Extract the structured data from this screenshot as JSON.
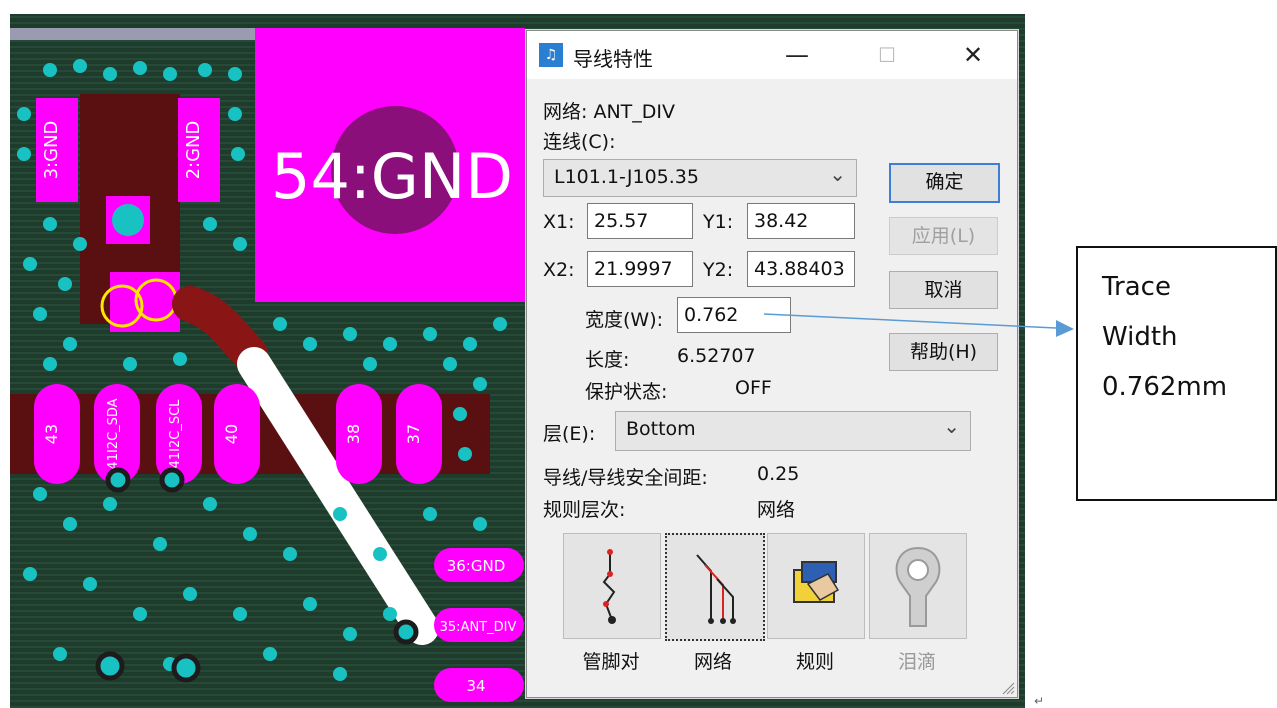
{
  "pcb": {
    "pad_big_label": "54:GND",
    "pad_labels": [
      "3:GND",
      "2:GND"
    ],
    "pin_labels": [
      "43",
      "41I2C_SDA",
      "41I2C_SCL",
      "40",
      "38",
      "37"
    ],
    "edge_pads": [
      "36:GND",
      "35:ANT_DIV",
      "34"
    ]
  },
  "dialog": {
    "title": "导线特性",
    "titlebar_buttons": {
      "minimize": "—",
      "maximize": "☐",
      "close": "✕"
    },
    "net_label": "网络: ANT_DIV",
    "connection_label": "连线(C):",
    "connection_value": "L101.1-J105.35",
    "x1_label": "X1:",
    "x1_value": "25.57",
    "y1_label": "Y1:",
    "y1_value": "38.42",
    "x2_label": "X2:",
    "x2_value": "21.9997",
    "y2_label": "Y2:",
    "y2_value": "43.88403",
    "width_label": "宽度(W):",
    "width_value": "0.762",
    "length_label": "长度:",
    "length_value": "6.52707",
    "protect_label": "保护状态:",
    "protect_value": "OFF",
    "layer_label": "层(E):",
    "layer_value": "Bottom",
    "clearance_label": "导线/导线安全间距:",
    "clearance_value": "0.25",
    "rule_level_label": "规则层次:",
    "rule_level_value": "网络",
    "buttons": {
      "ok": "确定",
      "apply": "应用(L)",
      "cancel": "取消",
      "help": "帮助(H)"
    },
    "big_buttons": [
      {
        "label": "管脚对",
        "icon": "pin-pair-icon",
        "enabled": true
      },
      {
        "label": "网络",
        "icon": "net-icon",
        "enabled": true
      },
      {
        "label": "规则",
        "icon": "rules-icon",
        "enabled": true
      },
      {
        "label": "泪滴",
        "icon": "teardrop-icon",
        "enabled": false
      }
    ]
  },
  "callout": {
    "lines": [
      "Trace",
      "Width",
      "0.762mm"
    ]
  },
  "colors": {
    "board": "#1e1b1d",
    "pad_magenta": "#ff00ff",
    "via_cyan": "#19c2c2",
    "trace_red": "#8a1515",
    "selected_trace": "#ffffff",
    "arrow_blue": "#5b9bd5"
  }
}
